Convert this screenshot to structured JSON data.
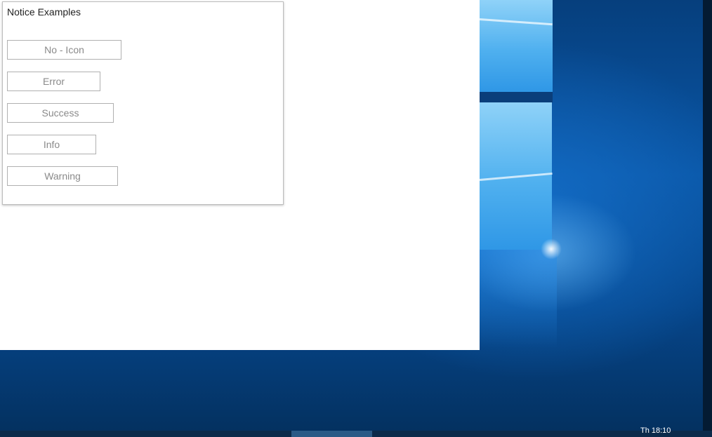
{
  "panel": {
    "title": "Notice Examples"
  },
  "buttons": {
    "no_icon": "No - Icon",
    "error": "Error",
    "success": "Success",
    "info": "Info",
    "warning": "Warning"
  },
  "taskbar": {
    "clock": "Th 18:10"
  },
  "colors": {
    "button_border": "#b0b0b0",
    "button_text": "#8a8a8a",
    "wallpaper": "#0a56a6"
  }
}
